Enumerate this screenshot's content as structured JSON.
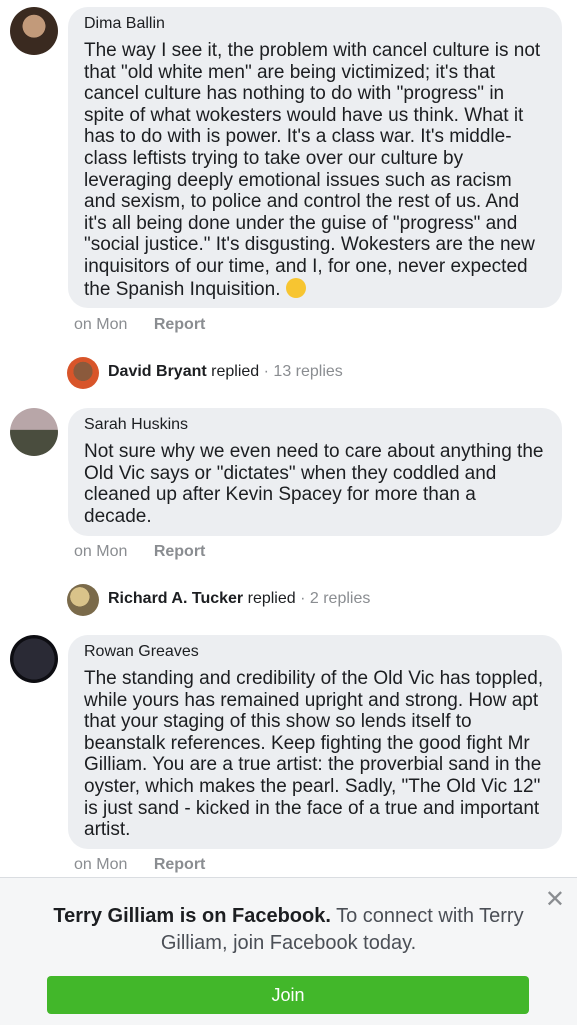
{
  "comments": [
    {
      "author": "Dima Ballin",
      "text": "The way I see it, the problem with cancel culture is not that \"old white men\" are being victimized; it's that cancel culture has nothing to do with \"progress\" in spite of what wokesters would have us think. What it has to do with is power. It's a class war. It's middle-class leftists trying to take over our culture by leveraging deeply emotional issues such as racism and sexism, to police and control the rest of us. And it's all being done under the guise of \"progress\" and \"social justice.\" It's disgusting. Wokesters are the new inquisitors of our time, and I, for one, never expected the Spanish Inquisition.",
      "emoji": "wink-emoji",
      "time": "on Mon",
      "report": "Report",
      "reply": {
        "name": "David Bryant",
        "verb": "replied",
        "count": "13 replies"
      }
    },
    {
      "author": "Sarah Huskins",
      "text": "Not sure why we even need to care about anything the Old Vic says or \"dictates\" when they coddled and cleaned up after Kevin Spacey for more than a decade.",
      "time": "on Mon",
      "report": "Report",
      "reply": {
        "name": "Richard A. Tucker",
        "verb": "replied",
        "count": "2 replies"
      }
    },
    {
      "author": "Rowan Greaves",
      "text": "The standing and credibility of the Old Vic has toppled, while yours has remained upright and strong. How apt that your staging of this show so lends itself to beanstalk references. Keep fighting the good fight Mr Gilliam. You are a true artist: the proverbial sand in the oyster, which makes the pearl. Sadly, \"The Old Vic 12\" is just sand - kicked in the face of a true and important artist.",
      "time": "on Mon",
      "report": "Report"
    }
  ],
  "banner": {
    "bold": "Terry Gilliam is on Facebook.",
    "rest": " To connect with Terry Gilliam, join Facebook today.",
    "join_label": "Join",
    "close_icon": "close-icon"
  },
  "colors": {
    "bubble": "#eceef1",
    "meta": "#8a8d91",
    "join": "#42b72a"
  }
}
